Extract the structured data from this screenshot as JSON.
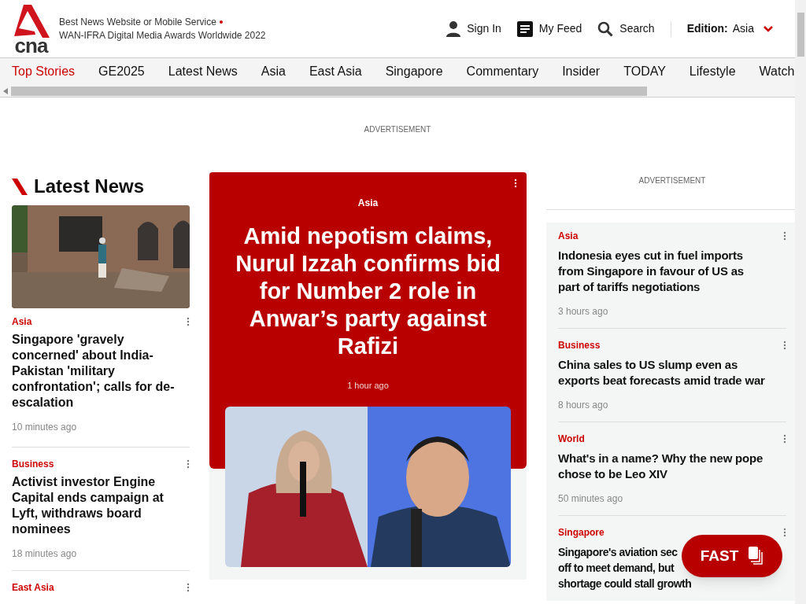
{
  "header": {
    "logo_text": "cna",
    "award_line_1": "Best News Website or Mobile Service",
    "award_line_2": "WAN-IFRA Digital Media Awards Worldwide 2022",
    "actions": [
      {
        "kind": "user",
        "label": "Sign In"
      },
      {
        "kind": "feed",
        "label": "My Feed"
      },
      {
        "kind": "search",
        "label": "Search"
      }
    ],
    "edition": {
      "label": "Edition:",
      "value": "Asia"
    }
  },
  "nav": {
    "items": [
      {
        "label": "Top Stories",
        "selected": true
      },
      {
        "label": "GE2025",
        "selected": false
      },
      {
        "label": "Latest News",
        "selected": false
      },
      {
        "label": "Asia",
        "selected": false
      },
      {
        "label": "East Asia",
        "selected": false
      },
      {
        "label": "Singapore",
        "selected": false
      },
      {
        "label": "Commentary",
        "selected": false
      },
      {
        "label": "Insider",
        "selected": false
      },
      {
        "label": "TODAY",
        "selected": false
      },
      {
        "label": "Lifestyle",
        "selected": false
      },
      {
        "label": "Watch",
        "selected": false
      }
    ]
  },
  "top_ad": "ADVERTISEMENT",
  "latest": {
    "title": "Latest News",
    "items": [
      {
        "category": "Asia",
        "headline": "Singapore 'gravely concerned' about India-Pakistan 'military confrontation'; calls for de-escalation",
        "time": "10 minutes ago"
      },
      {
        "category": "Business",
        "headline": "Activist investor Engine Capital ends campaign at Lyft, withdraws board nominees",
        "time": "18 minutes ago"
      },
      {
        "category": "East Asia"
      }
    ]
  },
  "feature": {
    "category": "Asia",
    "headline": "Amid nepotism claims, Nurul Izzah confirms bid for Number 2 role in Anwar’s party against Rafizi",
    "time": "1 hour ago"
  },
  "side_ad": "ADVERTISEMENT",
  "side": {
    "items": [
      {
        "category": "Asia",
        "headline": "Indonesia eyes cut in fuel imports from Singapore in favour of US as part of tariffs negotiations",
        "time": "3 hours ago"
      },
      {
        "category": "Business",
        "headline": "China sales to US slump even as exports beat forecasts amid trade war",
        "time": "8 hours ago"
      },
      {
        "category": "World",
        "headline": "What's in a name? Why the new pope chose to be Leo XIV",
        "time": "50 minutes ago"
      },
      {
        "category": "Singapore",
        "headline_lines": [
          "Singapore's aviation sec",
          "off to meet demand, but",
          "shortage could stall growth"
        ]
      }
    ]
  },
  "fast_button": "FAST"
}
